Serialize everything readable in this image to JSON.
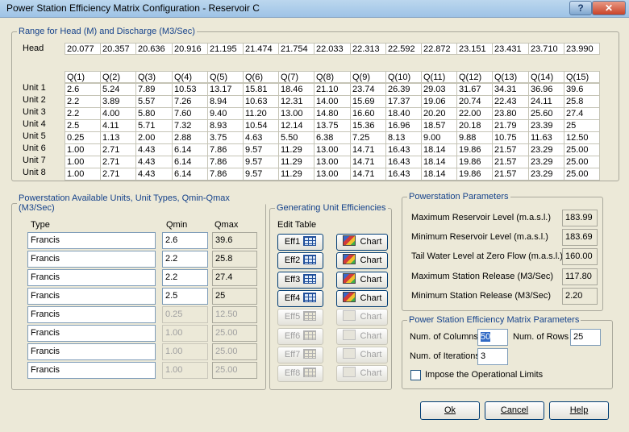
{
  "window": {
    "title": "Power Station Efficiency Matrix Configuration - Reservoir C",
    "help_glyph": "?",
    "close_glyph": "✕"
  },
  "range": {
    "legend": "Range for Head (M) and Discharge (M3/Sec)",
    "head_label": "Head",
    "head_values": [
      "20.077",
      "20.357",
      "20.636",
      "20.916",
      "21.195",
      "21.474",
      "21.754",
      "22.033",
      "22.313",
      "22.592",
      "22.872",
      "23.151",
      "23.431",
      "23.710",
      "23.990"
    ],
    "q_headers": [
      "Q(1)",
      "Q(2)",
      "Q(3)",
      "Q(4)",
      "Q(5)",
      "Q(6)",
      "Q(7)",
      "Q(8)",
      "Q(9)",
      "Q(10)",
      "Q(11)",
      "Q(12)",
      "Q(13)",
      "Q(14)",
      "Q(15)"
    ],
    "units": [
      {
        "label": "Unit 1",
        "values": [
          "2.6",
          "5.24",
          "7.89",
          "10.53",
          "13.17",
          "15.81",
          "18.46",
          "21.10",
          "23.74",
          "26.39",
          "29.03",
          "31.67",
          "34.31",
          "36.96",
          "39.6"
        ]
      },
      {
        "label": "Unit 2",
        "values": [
          "2.2",
          "3.89",
          "5.57",
          "7.26",
          "8.94",
          "10.63",
          "12.31",
          "14.00",
          "15.69",
          "17.37",
          "19.06",
          "20.74",
          "22.43",
          "24.11",
          "25.8"
        ]
      },
      {
        "label": "Unit 3",
        "values": [
          "2.2",
          "4.00",
          "5.80",
          "7.60",
          "9.40",
          "11.20",
          "13.00",
          "14.80",
          "16.60",
          "18.40",
          "20.20",
          "22.00",
          "23.80",
          "25.60",
          "27.4"
        ]
      },
      {
        "label": "Unit 4",
        "values": [
          "2.5",
          "4.11",
          "5.71",
          "7.32",
          "8.93",
          "10.54",
          "12.14",
          "13.75",
          "15.36",
          "16.96",
          "18.57",
          "20.18",
          "21.79",
          "23.39",
          "25"
        ]
      },
      {
        "label": "Unit 5",
        "values": [
          "0.25",
          "1.13",
          "2.00",
          "2.88",
          "3.75",
          "4.63",
          "5.50",
          "6.38",
          "7.25",
          "8.13",
          "9.00",
          "9.88",
          "10.75",
          "11.63",
          "12.50"
        ]
      },
      {
        "label": "Unit 6",
        "values": [
          "1.00",
          "2.71",
          "4.43",
          "6.14",
          "7.86",
          "9.57",
          "11.29",
          "13.00",
          "14.71",
          "16.43",
          "18.14",
          "19.86",
          "21.57",
          "23.29",
          "25.00"
        ]
      },
      {
        "label": "Unit 7",
        "values": [
          "1.00",
          "2.71",
          "4.43",
          "6.14",
          "7.86",
          "9.57",
          "11.29",
          "13.00",
          "14.71",
          "16.43",
          "18.14",
          "19.86",
          "21.57",
          "23.29",
          "25.00"
        ]
      },
      {
        "label": "Unit 8",
        "values": [
          "1.00",
          "2.71",
          "4.43",
          "6.14",
          "7.86",
          "9.57",
          "11.29",
          "13.00",
          "14.71",
          "16.43",
          "18.14",
          "19.86",
          "21.57",
          "23.29",
          "25.00"
        ]
      }
    ]
  },
  "units_panel": {
    "legend": "Powerstation Available Units, Unit Types, Qmin-Qmax (M3/Sec)",
    "col_type": "Type",
    "col_qmin": "Qmin",
    "col_qmax": "Qmax",
    "rows": [
      {
        "type": "Francis",
        "qmin": "2.6",
        "qmax": "39.6",
        "enabled": true
      },
      {
        "type": "Francis",
        "qmin": "2.2",
        "qmax": "25.8",
        "enabled": true
      },
      {
        "type": "Francis",
        "qmin": "2.2",
        "qmax": "27.4",
        "enabled": true
      },
      {
        "type": "Francis",
        "qmin": "2.5",
        "qmax": "25",
        "enabled": true
      },
      {
        "type": "Francis",
        "qmin": "0.25",
        "qmax": "12.50",
        "enabled": false
      },
      {
        "type": "Francis",
        "qmin": "1.00",
        "qmax": "25.00",
        "enabled": false
      },
      {
        "type": "Francis",
        "qmin": "1.00",
        "qmax": "25.00",
        "enabled": false
      },
      {
        "type": "Francis",
        "qmin": "1.00",
        "qmax": "25.00",
        "enabled": false
      }
    ]
  },
  "gen_panel": {
    "legend": "Generating Unit Efficiencies",
    "edit_table_label": "Edit Table",
    "chart_label": "Chart",
    "eff_buttons": [
      {
        "label": "Eff1",
        "enabled": true
      },
      {
        "label": "Eff2",
        "enabled": true
      },
      {
        "label": "Eff3",
        "enabled": true
      },
      {
        "label": "Eff4",
        "enabled": true
      },
      {
        "label": "Eff5",
        "enabled": false
      },
      {
        "label": "Eff6",
        "enabled": false
      },
      {
        "label": "Eff7",
        "enabled": false
      },
      {
        "label": "Eff8",
        "enabled": false
      }
    ]
  },
  "params_panel": {
    "legend": "Powerstation Parameters",
    "items": [
      {
        "label": "Maximum Reservoir Level (m.a.s.l.)",
        "value": "183.99"
      },
      {
        "label": "Minimum Reservoir Level (m.a.s.l.)",
        "value": "183.69"
      },
      {
        "label": "Tail Water Level at Zero Flow (m.a.s.l.)",
        "value": "160.00"
      },
      {
        "label": "Maximum Station Release (M3/Sec)",
        "value": "117.80"
      },
      {
        "label": "Minimum Station Release (M3/Sec)",
        "value": "2.20"
      }
    ]
  },
  "matrix_panel": {
    "legend": "Power Station Efficiency Matrix Parameters",
    "columns_label": "Num. of Columns",
    "columns_value": "50",
    "rows_label": "Num. of Rows",
    "rows_value": "25",
    "iterations_label": "Num. of Iterations",
    "iterations_value": "3",
    "limits_label": "Impose the Operational Limits",
    "limits_checked": false
  },
  "footer": {
    "ok_label": "Ok",
    "cancel_label": "Cancel",
    "help_label": "Help"
  }
}
